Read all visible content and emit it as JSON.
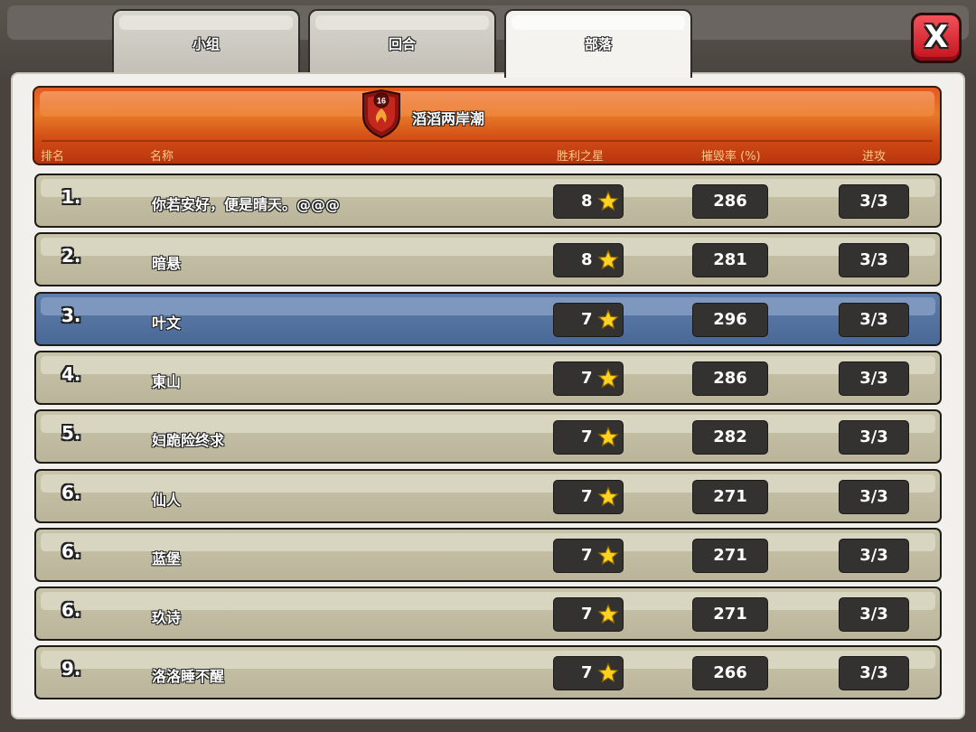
{
  "tabs": [
    {
      "label": "小组",
      "active": false
    },
    {
      "label": "回合",
      "active": false
    },
    {
      "label": "部落",
      "active": true
    }
  ],
  "close_button": {
    "label": "X"
  },
  "clan": {
    "name": "滔滔两岸潮",
    "level": "16",
    "colors": {
      "header": "#e07028",
      "highlight_row": "#4f6e9c",
      "row": "#c3bfa4"
    }
  },
  "columns": {
    "rank": "排名",
    "name": "名称",
    "stars": "胜利之星",
    "destruction": "摧毁率 (%)",
    "attacks": "进攻"
  },
  "players": [
    {
      "rank": "1.",
      "name": "你若安好，便是晴天。@@@",
      "stars": "8",
      "destruction": "286",
      "attacks": "3/3"
    },
    {
      "rank": "2.",
      "name": "暗悬",
      "stars": "8",
      "destruction": "281",
      "attacks": "3/3"
    },
    {
      "rank": "3.",
      "name": "叶文",
      "stars": "7",
      "destruction": "296",
      "attacks": "3/3",
      "highlight": true
    },
    {
      "rank": "4.",
      "name": "東山",
      "stars": "7",
      "destruction": "286",
      "attacks": "3/3"
    },
    {
      "rank": "5.",
      "name": "妇跪险终求",
      "stars": "7",
      "destruction": "282",
      "attacks": "3/3"
    },
    {
      "rank": "6.",
      "name": "仙人",
      "stars": "7",
      "destruction": "271",
      "attacks": "3/3"
    },
    {
      "rank": "6.",
      "name": "蓝堡",
      "stars": "7",
      "destruction": "271",
      "attacks": "3/3"
    },
    {
      "rank": "6.",
      "name": "玖诗",
      "stars": "7",
      "destruction": "271",
      "attacks": "3/3"
    },
    {
      "rank": "9.",
      "name": "洛洛睡不醒",
      "stars": "7",
      "destruction": "266",
      "attacks": "3/3"
    }
  ],
  "icons": {
    "star": "star-icon",
    "badge": "clan-badge-icon",
    "close": "close-icon"
  }
}
